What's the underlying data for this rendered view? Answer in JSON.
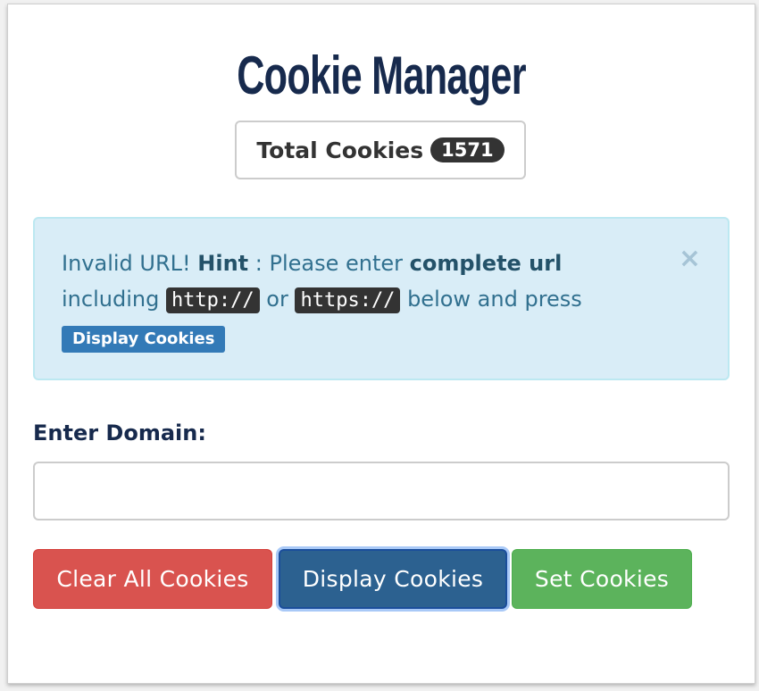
{
  "title": "Cookie Manager",
  "total": {
    "label": "Total Cookies",
    "count": "1571"
  },
  "alert": {
    "part1": "Invalid URL! ",
    "hint": "Hint",
    "part2": " : Please enter ",
    "complete": "complete url",
    "part3": " including ",
    "code1": "http://",
    "or": " or ",
    "code2": "https://",
    "part4": " below and press ",
    "button": "Display Cookies",
    "close": "×"
  },
  "domain": {
    "label": "Enter Domain:",
    "value": "",
    "placeholder": ""
  },
  "buttons": {
    "clear": "Clear All Cookies",
    "display": "Display Cookies",
    "set": "Set Cookies"
  },
  "colors": {
    "title": "#172a4d",
    "danger": "#d9534f",
    "primary": "#2c6190",
    "success": "#5cb35c",
    "info_bg": "#d9edf7"
  }
}
